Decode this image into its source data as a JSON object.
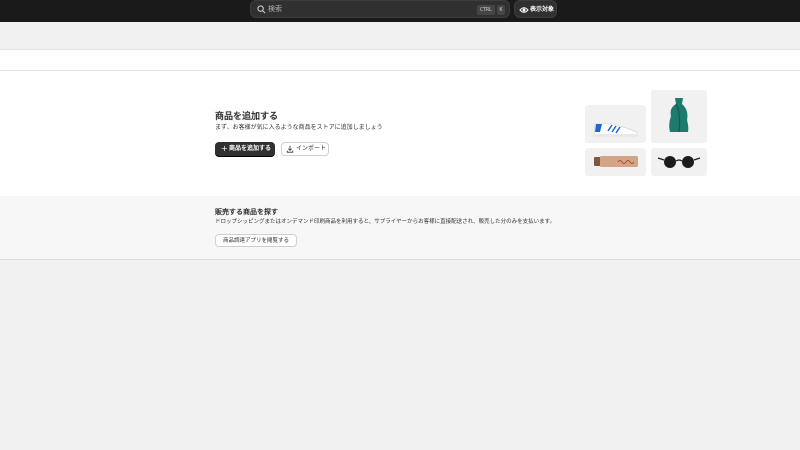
{
  "topbar": {
    "search": {
      "placeholder": "検索",
      "shortcut_ctrl": "CTRL",
      "shortcut_key": "K"
    },
    "view_button_label": "表示対象"
  },
  "add_product": {
    "title": "商品を追加する",
    "description": "まず、お客様が気に入るような商品をストアに追加しましょう",
    "primary_button": "商品を追加する",
    "secondary_button": "インポート"
  },
  "find_products": {
    "title": "販売する商品を探す",
    "description": "ドロップシッピングまたはオンデマンド印刷商品を利用すると、サプライヤーからお客様に直接配送され、販売した分のみを支払います。",
    "button": "商品調達アプリを閲覧する"
  },
  "colors": {
    "topbar": "#1a1a1a",
    "primary_button": "#303030",
    "vase": "#1f7a6e",
    "shoe_stripes": "#2366d1"
  }
}
